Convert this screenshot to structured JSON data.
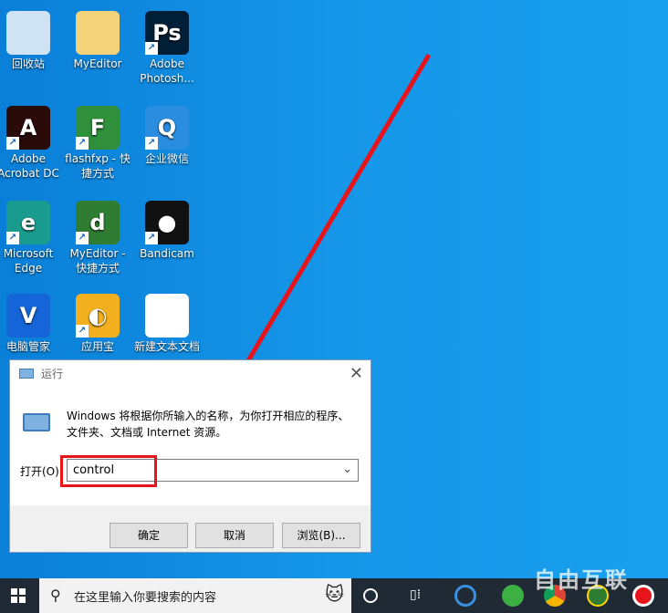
{
  "desktop": {
    "icons": [
      {
        "label": "回收站",
        "color": "#cfe3f5",
        "shortcut": false
      },
      {
        "label": "MyEditor",
        "color": "#f3d27a",
        "shortcut": false
      },
      {
        "label": "Adobe Photosh...",
        "color": "#001e36",
        "glyph": "Ps",
        "shortcut": true
      },
      {
        "label": "Adobe Acrobat DC",
        "color": "#2b0a0a",
        "glyph": "A",
        "shortcut": true
      },
      {
        "label": "flashfxp - 快捷方式",
        "color": "#2f8f3a",
        "glyph": "F",
        "shortcut": true
      },
      {
        "label": "企业微信",
        "color": "#2a8de0",
        "glyph": "Q",
        "shortcut": true
      },
      {
        "label": "Microsoft Edge",
        "color": "#1a9b8f",
        "glyph": "e",
        "shortcut": true
      },
      {
        "label": "MyEditor - 快捷方式",
        "color": "#2e7d32",
        "glyph": "d",
        "shortcut": true
      },
      {
        "label": "Bandicam",
        "color": "#111111",
        "glyph": "●",
        "shortcut": true
      },
      {
        "label": "电脑管家",
        "color": "#1565d8",
        "glyph": "V",
        "shortcut": false
      },
      {
        "label": "应用宝",
        "color": "#f2b01e",
        "glyph": "◐",
        "shortcut": true
      },
      {
        "label": "新建文本文档",
        "color": "#ffffff",
        "glyph": "",
        "shortcut": false
      }
    ]
  },
  "run_dialog": {
    "title": "运行",
    "description": "Windows 将根据你所输入的名称，为你打开相应的程序、文件夹、文档或 Internet 资源。",
    "open_label": "打开(O):",
    "input_value": "control",
    "ok": "确定",
    "cancel": "取消",
    "browse": "浏览(B)..."
  },
  "annotation": {
    "color": "#e8141c"
  },
  "taskbar": {
    "search_placeholder": "在这里输入你要搜索的内容",
    "watermark": "自由互联"
  }
}
